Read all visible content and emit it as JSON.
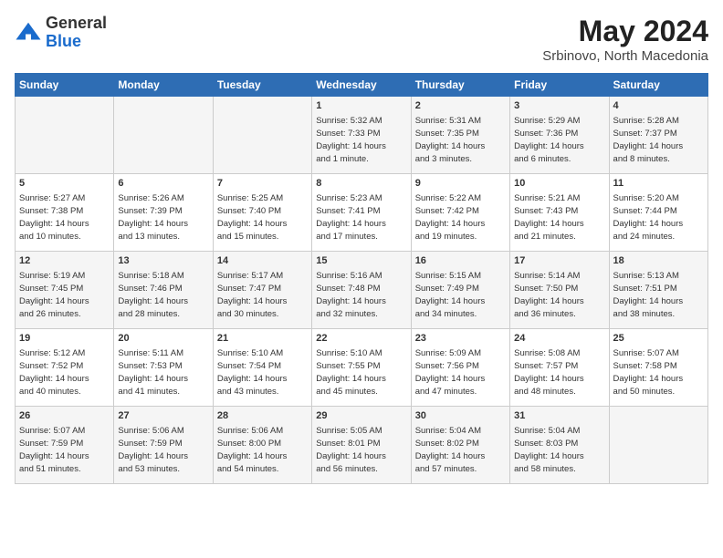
{
  "header": {
    "logo_general": "General",
    "logo_blue": "Blue",
    "month_year": "May 2024",
    "location": "Srbinovo, North Macedonia"
  },
  "weekdays": [
    "Sunday",
    "Monday",
    "Tuesday",
    "Wednesday",
    "Thursday",
    "Friday",
    "Saturday"
  ],
  "weeks": [
    [
      {
        "day": "",
        "info": ""
      },
      {
        "day": "",
        "info": ""
      },
      {
        "day": "",
        "info": ""
      },
      {
        "day": "1",
        "info": "Sunrise: 5:32 AM\nSunset: 7:33 PM\nDaylight: 14 hours\nand 1 minute."
      },
      {
        "day": "2",
        "info": "Sunrise: 5:31 AM\nSunset: 7:35 PM\nDaylight: 14 hours\nand 3 minutes."
      },
      {
        "day": "3",
        "info": "Sunrise: 5:29 AM\nSunset: 7:36 PM\nDaylight: 14 hours\nand 6 minutes."
      },
      {
        "day": "4",
        "info": "Sunrise: 5:28 AM\nSunset: 7:37 PM\nDaylight: 14 hours\nand 8 minutes."
      }
    ],
    [
      {
        "day": "5",
        "info": "Sunrise: 5:27 AM\nSunset: 7:38 PM\nDaylight: 14 hours\nand 10 minutes."
      },
      {
        "day": "6",
        "info": "Sunrise: 5:26 AM\nSunset: 7:39 PM\nDaylight: 14 hours\nand 13 minutes."
      },
      {
        "day": "7",
        "info": "Sunrise: 5:25 AM\nSunset: 7:40 PM\nDaylight: 14 hours\nand 15 minutes."
      },
      {
        "day": "8",
        "info": "Sunrise: 5:23 AM\nSunset: 7:41 PM\nDaylight: 14 hours\nand 17 minutes."
      },
      {
        "day": "9",
        "info": "Sunrise: 5:22 AM\nSunset: 7:42 PM\nDaylight: 14 hours\nand 19 minutes."
      },
      {
        "day": "10",
        "info": "Sunrise: 5:21 AM\nSunset: 7:43 PM\nDaylight: 14 hours\nand 21 minutes."
      },
      {
        "day": "11",
        "info": "Sunrise: 5:20 AM\nSunset: 7:44 PM\nDaylight: 14 hours\nand 24 minutes."
      }
    ],
    [
      {
        "day": "12",
        "info": "Sunrise: 5:19 AM\nSunset: 7:45 PM\nDaylight: 14 hours\nand 26 minutes."
      },
      {
        "day": "13",
        "info": "Sunrise: 5:18 AM\nSunset: 7:46 PM\nDaylight: 14 hours\nand 28 minutes."
      },
      {
        "day": "14",
        "info": "Sunrise: 5:17 AM\nSunset: 7:47 PM\nDaylight: 14 hours\nand 30 minutes."
      },
      {
        "day": "15",
        "info": "Sunrise: 5:16 AM\nSunset: 7:48 PM\nDaylight: 14 hours\nand 32 minutes."
      },
      {
        "day": "16",
        "info": "Sunrise: 5:15 AM\nSunset: 7:49 PM\nDaylight: 14 hours\nand 34 minutes."
      },
      {
        "day": "17",
        "info": "Sunrise: 5:14 AM\nSunset: 7:50 PM\nDaylight: 14 hours\nand 36 minutes."
      },
      {
        "day": "18",
        "info": "Sunrise: 5:13 AM\nSunset: 7:51 PM\nDaylight: 14 hours\nand 38 minutes."
      }
    ],
    [
      {
        "day": "19",
        "info": "Sunrise: 5:12 AM\nSunset: 7:52 PM\nDaylight: 14 hours\nand 40 minutes."
      },
      {
        "day": "20",
        "info": "Sunrise: 5:11 AM\nSunset: 7:53 PM\nDaylight: 14 hours\nand 41 minutes."
      },
      {
        "day": "21",
        "info": "Sunrise: 5:10 AM\nSunset: 7:54 PM\nDaylight: 14 hours\nand 43 minutes."
      },
      {
        "day": "22",
        "info": "Sunrise: 5:10 AM\nSunset: 7:55 PM\nDaylight: 14 hours\nand 45 minutes."
      },
      {
        "day": "23",
        "info": "Sunrise: 5:09 AM\nSunset: 7:56 PM\nDaylight: 14 hours\nand 47 minutes."
      },
      {
        "day": "24",
        "info": "Sunrise: 5:08 AM\nSunset: 7:57 PM\nDaylight: 14 hours\nand 48 minutes."
      },
      {
        "day": "25",
        "info": "Sunrise: 5:07 AM\nSunset: 7:58 PM\nDaylight: 14 hours\nand 50 minutes."
      }
    ],
    [
      {
        "day": "26",
        "info": "Sunrise: 5:07 AM\nSunset: 7:59 PM\nDaylight: 14 hours\nand 51 minutes."
      },
      {
        "day": "27",
        "info": "Sunrise: 5:06 AM\nSunset: 7:59 PM\nDaylight: 14 hours\nand 53 minutes."
      },
      {
        "day": "28",
        "info": "Sunrise: 5:06 AM\nSunset: 8:00 PM\nDaylight: 14 hours\nand 54 minutes."
      },
      {
        "day": "29",
        "info": "Sunrise: 5:05 AM\nSunset: 8:01 PM\nDaylight: 14 hours\nand 56 minutes."
      },
      {
        "day": "30",
        "info": "Sunrise: 5:04 AM\nSunset: 8:02 PM\nDaylight: 14 hours\nand 57 minutes."
      },
      {
        "day": "31",
        "info": "Sunrise: 5:04 AM\nSunset: 8:03 PM\nDaylight: 14 hours\nand 58 minutes."
      },
      {
        "day": "",
        "info": ""
      }
    ]
  ]
}
